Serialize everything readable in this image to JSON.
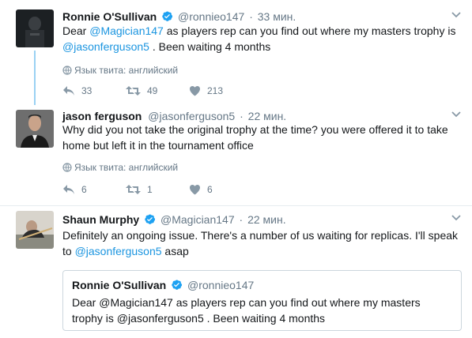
{
  "tweets": [
    {
      "name": "Ronnie O'Sullivan",
      "handle": "@ronnieo147",
      "dot": "·",
      "time": "33 мин.",
      "text_parts": [
        "Dear ",
        "@Magician147",
        " as players rep can you find out where my masters trophy is ",
        "@jasonferguson5",
        " . Been waiting 4 months"
      ],
      "lang": "Язык твита: английский",
      "replies": "33",
      "retweets": "49",
      "likes": "213"
    },
    {
      "name": "jason ferguson",
      "handle": "@jasonferguson5",
      "dot": "·",
      "time": "22 мин.",
      "text": "Why did you not take the original trophy at the time? you were offered it to take home but left it in the tournament office",
      "lang": "Язык твита: английский",
      "replies": "6",
      "retweets": "1",
      "likes": "6"
    },
    {
      "name": "Shaun Murphy",
      "handle": "@Magician147",
      "dot": "·",
      "time": "22 мин.",
      "text_parts": [
        "Definitely an ongoing issue. There's a number of us waiting for replicas. I'll speak to ",
        "@jasonferguson5",
        " asap"
      ]
    }
  ],
  "quote": {
    "name": "Ronnie O'Sullivan",
    "handle": "@ronnieo147",
    "text": "Dear @Magician147 as players rep can you find out where my masters trophy is @jasonferguson5 . Been waiting 4 months"
  },
  "icons": {
    "caret": "chevron-down-icon",
    "verified": "verified-badge-icon",
    "globe": "globe-icon",
    "reply": "reply-icon",
    "retweet": "retweet-icon",
    "like": "heart-icon"
  },
  "colors": {
    "link": "#1b95e0",
    "secondary": "#657786",
    "thread_line": "#9ad1f3",
    "verified": "#1da1f2"
  }
}
